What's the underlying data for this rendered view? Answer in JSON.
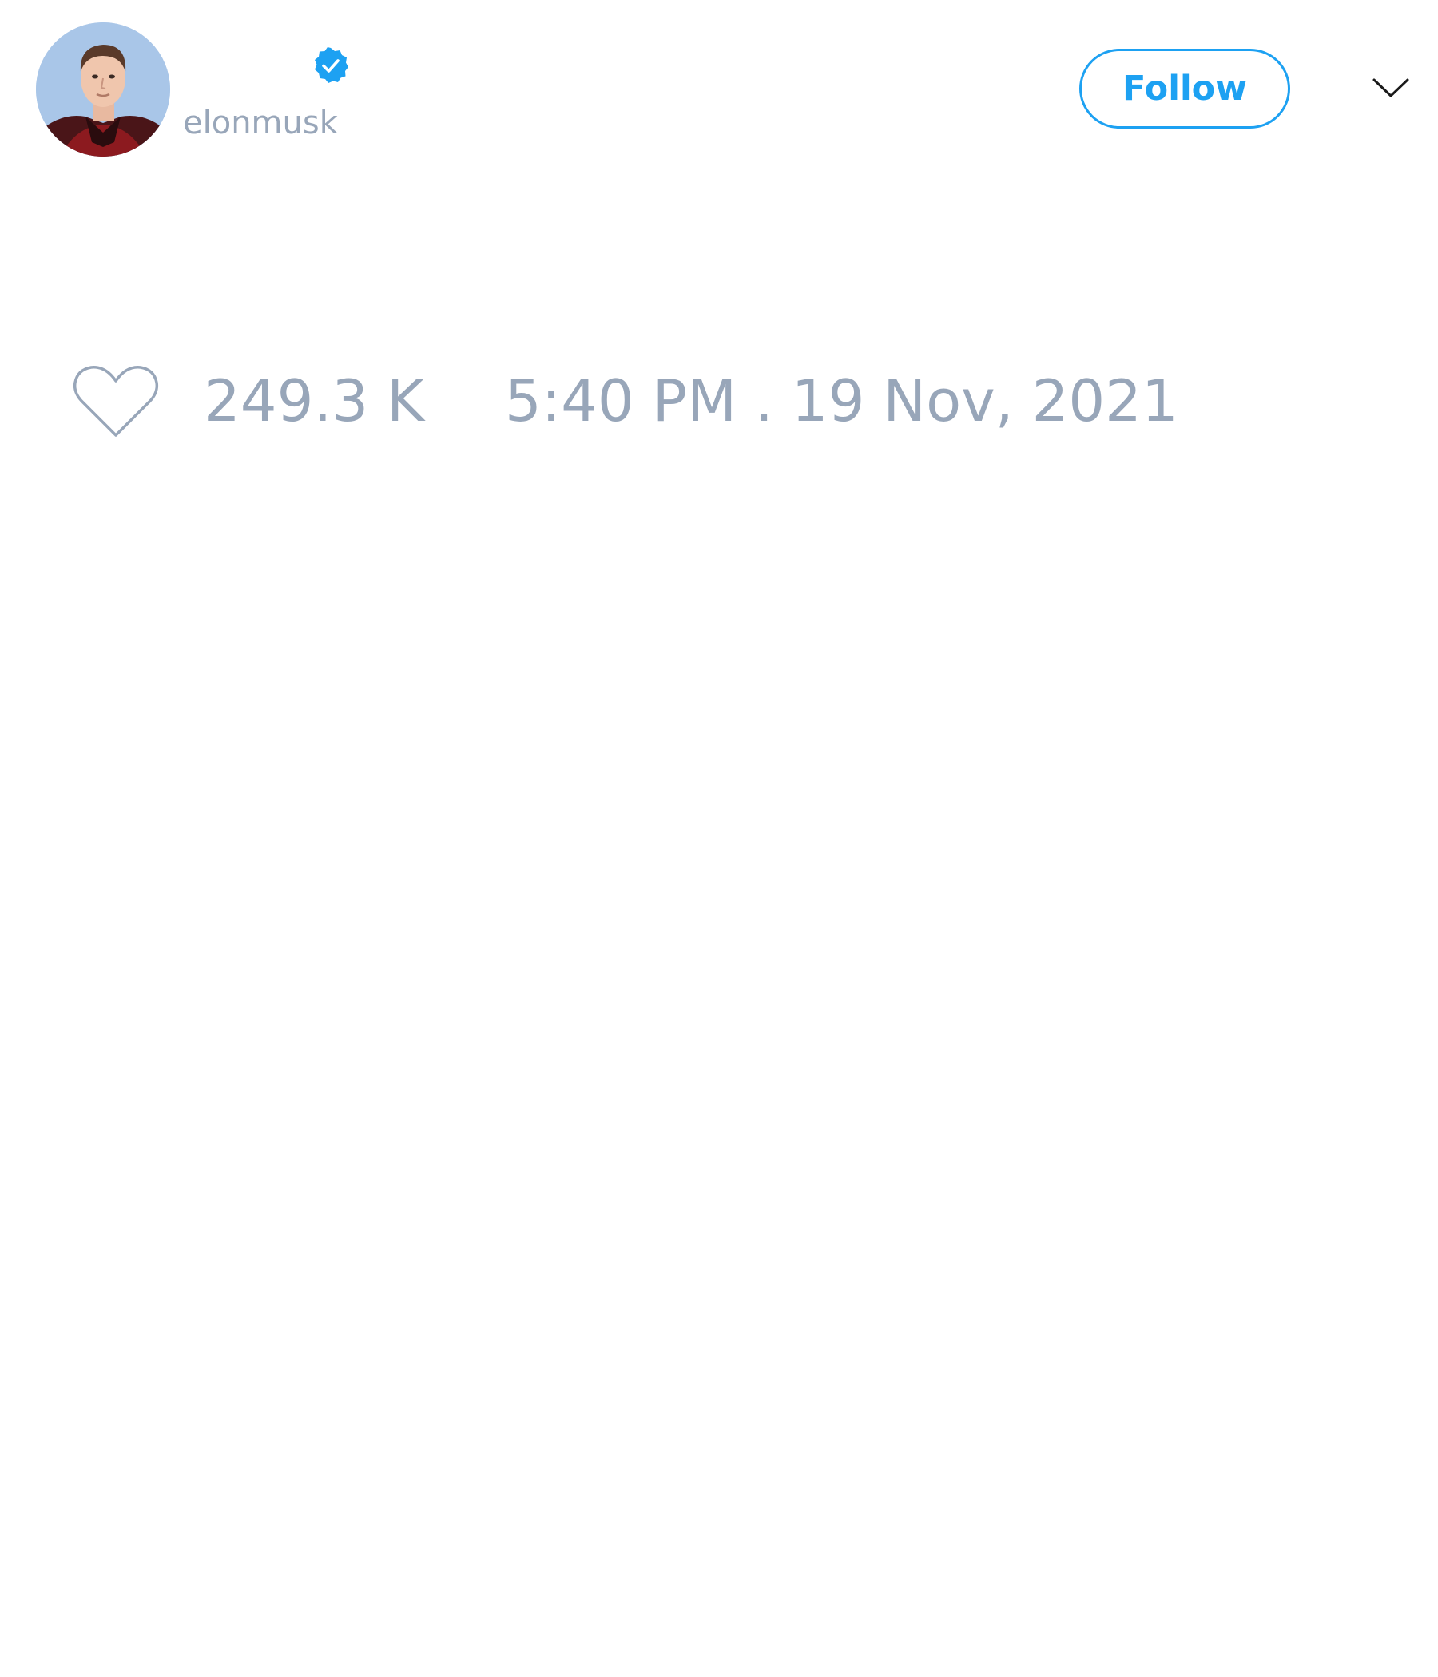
{
  "tweet": {
    "author": {
      "display_name": "",
      "handle": "elonmusk",
      "verified": true,
      "avatar_icon": "profile-photo"
    },
    "follow_label": "Follow",
    "menu_icon": "chevron-down-icon",
    "like_icon": "heart-icon",
    "like_count": "249.3 K",
    "timestamp": "5:40 PM . 19 Nov, 2021"
  },
  "colors": {
    "accent": "#1da1f2",
    "muted_text": "#98a6b9",
    "background": "#ffffff"
  }
}
